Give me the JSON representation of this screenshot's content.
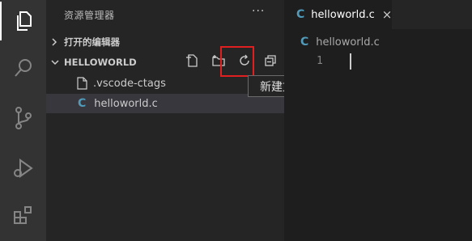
{
  "activity_bar": {
    "icons": [
      "explorer-icon",
      "search-icon",
      "source-control-icon",
      "run-debug-icon",
      "extensions-icon"
    ],
    "accent": "#ffffff"
  },
  "sidebar": {
    "title": "资源管理器",
    "more": "···",
    "open_editors_label": "打开的编辑器",
    "folder_label": "HELLOWORLD",
    "toolbar": [
      "new-file-icon",
      "new-folder-icon",
      "refresh-icon",
      "collapse-all-icon"
    ],
    "files": [
      {
        "name": ".vscode-ctags",
        "icon": "file-icon"
      },
      {
        "name": "helloworld.c",
        "icon": "c-file-icon",
        "selected": true
      }
    ],
    "tooltip": "新建文件",
    "highlight_color": "#e02020"
  },
  "editor": {
    "tab": {
      "label": "helloworld.c",
      "close": "×",
      "icon_glyph": "C"
    },
    "breadcrumb": {
      "label": "helloworld.c",
      "icon_glyph": "C"
    },
    "line_number": "1",
    "c_icon_color": "#519aba"
  }
}
